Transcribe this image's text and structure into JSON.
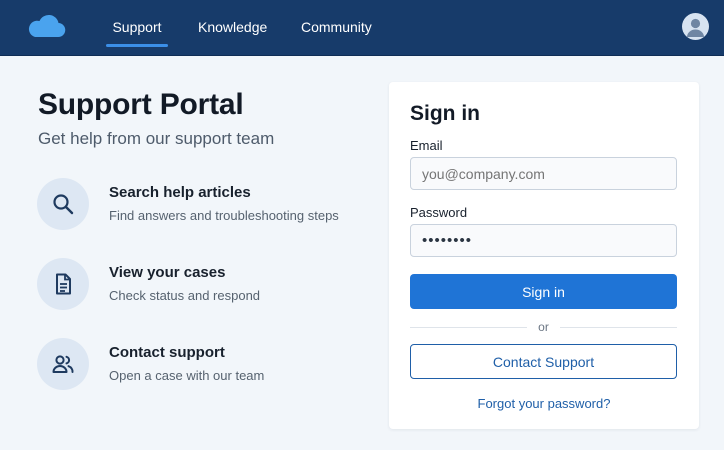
{
  "colors": {
    "topbar": "#173b6a",
    "accent": "#1f74d6",
    "nav_underline": "#3b8fe8",
    "page_background": "#f2f6fa"
  },
  "header": {
    "logo_icon": "cloud-icon",
    "nav": [
      {
        "label": "Support",
        "active": true
      },
      {
        "label": "Knowledge",
        "active": false
      },
      {
        "label": "Community",
        "active": false
      }
    ],
    "avatar_icon": "user-avatar-icon"
  },
  "hero": {
    "title": "Support Portal",
    "subtitle": "Get help from our support team"
  },
  "features": [
    {
      "icon": "search-icon",
      "title": "Search help articles",
      "description": "Find answers and troubleshooting steps"
    },
    {
      "icon": "document-icon",
      "title": "View your cases",
      "description": "Check status and respond"
    },
    {
      "icon": "people-icon",
      "title": "Contact support",
      "description": "Open a case with our team"
    }
  ],
  "signin": {
    "title": "Sign in",
    "email_label": "Email",
    "email_placeholder": "you@company.com",
    "password_label": "Password",
    "password_value": "••••••••",
    "submit_label": "Sign in",
    "divider_text": "or",
    "contact_label": "Contact Support",
    "forgot_link": "Forgot your password?"
  }
}
